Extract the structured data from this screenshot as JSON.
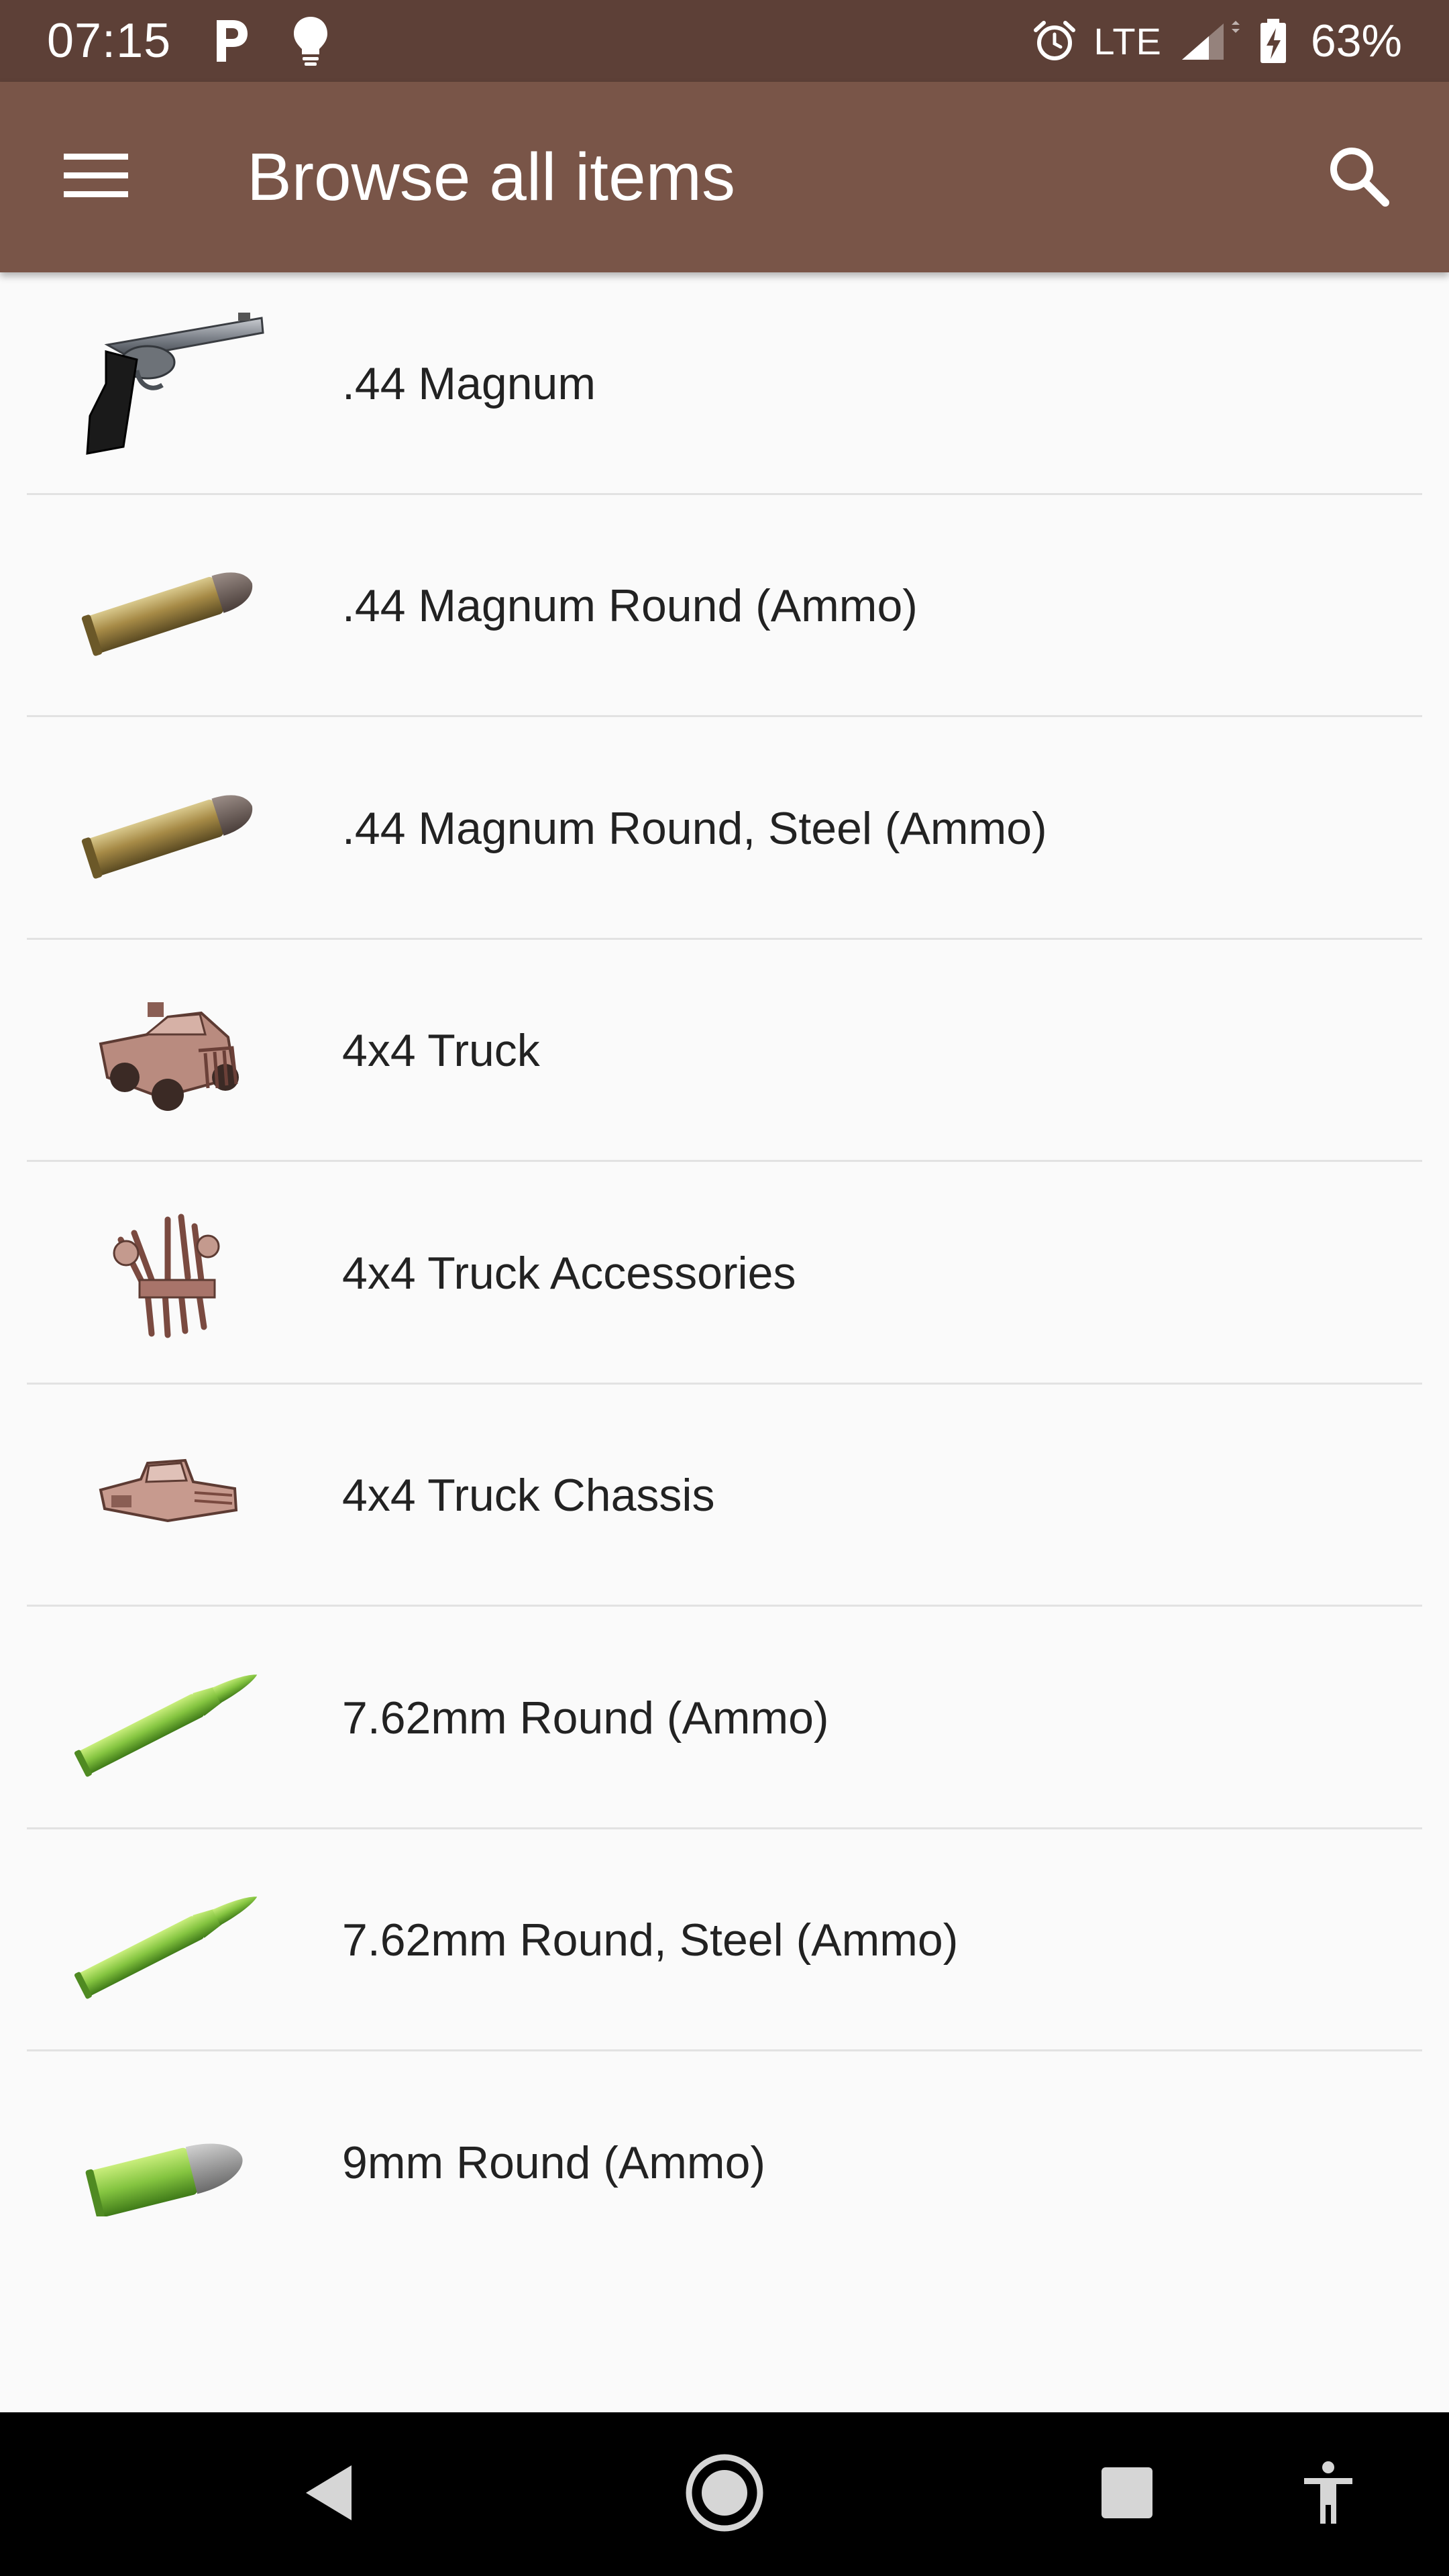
{
  "status_bar": {
    "time": "07:15",
    "network": "LTE",
    "battery": "63%",
    "icons": [
      "parking-icon",
      "lightbulb-icon",
      "alarm-icon",
      "signal-icon",
      "battery-charging-icon"
    ]
  },
  "app_bar": {
    "title": "Browse all items",
    "menu_icon": "menu-icon",
    "search_icon": "search-icon",
    "background": "#795548",
    "status_background": "#5d4037"
  },
  "items": [
    {
      "label": ".44 Magnum",
      "icon": "revolver-icon"
    },
    {
      "label": ".44 Magnum Round (Ammo)",
      "icon": "brass-bullet-icon"
    },
    {
      "label": ".44 Magnum Round, Steel (Ammo)",
      "icon": "brass-bullet-icon"
    },
    {
      "label": "4x4 Truck",
      "icon": "truck-icon"
    },
    {
      "label": "4x4 Truck Accessories",
      "icon": "truck-parts-icon"
    },
    {
      "label": "4x4 Truck Chassis",
      "icon": "truck-chassis-icon"
    },
    {
      "label": "7.62mm Round (Ammo)",
      "icon": "rifle-cartridge-icon"
    },
    {
      "label": "7.62mm Round, Steel (Ammo)",
      "icon": "rifle-cartridge-icon"
    },
    {
      "label": "9mm Round (Ammo)",
      "icon": "pistol-bullet-icon"
    }
  ],
  "nav_bar": {
    "icons": [
      "back-icon",
      "home-icon",
      "recents-icon",
      "accessibility-icon"
    ]
  }
}
